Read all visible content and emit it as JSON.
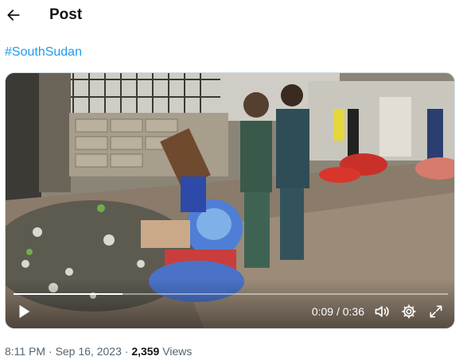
{
  "header": {
    "title": "Post"
  },
  "post": {
    "hashtag": "#SouthSudan"
  },
  "video": {
    "time_current": "0:09",
    "time_separator": "/",
    "time_total": "0:36",
    "progress_fraction": 0.25,
    "playing": false
  },
  "meta": {
    "time": "8:11 PM",
    "separator": "·",
    "date": "Sep 16, 2023",
    "views_count": "2,359",
    "views_label": "Views"
  },
  "icons": {
    "back": "arrow-left-icon",
    "play": "play-icon",
    "volume": "volume-icon",
    "settings": "gear-icon",
    "fullscreen": "fullscreen-icon"
  },
  "colors": {
    "link": "#1d9bf0",
    "muted": "#536471",
    "text": "#0f1419"
  }
}
